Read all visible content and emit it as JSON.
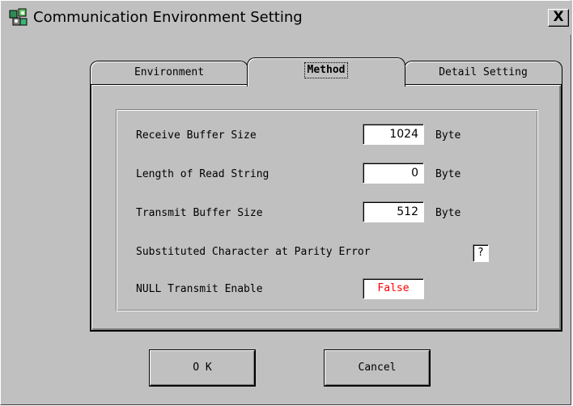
{
  "window": {
    "title": "Communication Environment Setting",
    "icon": "app-gear-icon",
    "close_label": "X"
  },
  "tabs": [
    {
      "label": "Environment",
      "active": false
    },
    {
      "label": "Method",
      "active": true
    },
    {
      "label": "Detail Setting",
      "active": false
    }
  ],
  "settings": {
    "receive_buffer": {
      "label": "Receive Buffer Size",
      "value": "1024",
      "unit": "Byte"
    },
    "read_length": {
      "label": "Length of Read String",
      "value": "0",
      "unit": "Byte"
    },
    "transmit_buffer": {
      "label": "Transmit Buffer Size",
      "value": "512",
      "unit": "Byte"
    },
    "parity_char": {
      "label": "Substituted Character at Parity Error",
      "value": "?"
    },
    "null_transmit": {
      "label": "NULL Transmit Enable",
      "value": "False",
      "color": "#ff0000"
    }
  },
  "buttons": {
    "ok": "O K",
    "cancel": "Cancel"
  },
  "colors": {
    "face": "#c0c0c0",
    "highlight": "#ffffff",
    "shadow": "#808080",
    "false_text": "#ff0000"
  }
}
